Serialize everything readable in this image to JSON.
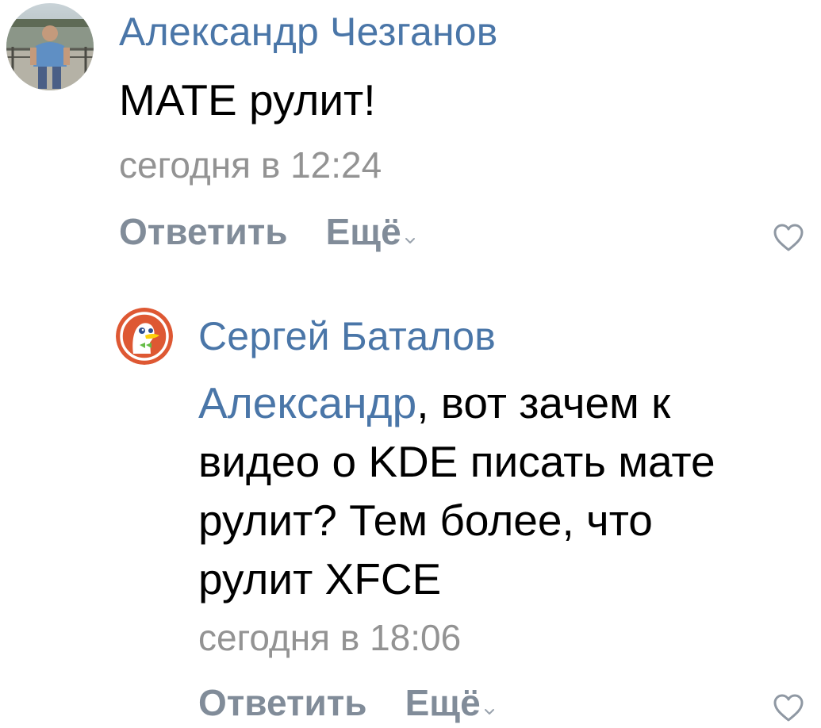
{
  "comments": [
    {
      "author": "Александр Чезганов",
      "text": "MATE рулит!",
      "time": "сегодня в 12:24",
      "reply_label": "Ответить",
      "more_label": "Ещё"
    },
    {
      "author": "Сергей Баталов",
      "mention": "Александр",
      "text": ", вот зачем к\nвидео о KDE писать мате\nрулит? Тем более, что\nрулит XFCE",
      "time": "сегодня в 18:06",
      "reply_label": "Ответить",
      "more_label": "Ещё"
    }
  ],
  "colors": {
    "link": "#4a76a8",
    "meta": "#939393",
    "action": "#818c99",
    "duck_red": "#de5833"
  },
  "icons": {
    "like": "heart-outline-icon",
    "more": "chevron-down-icon",
    "avatar2": "duckduckgo-logo"
  }
}
